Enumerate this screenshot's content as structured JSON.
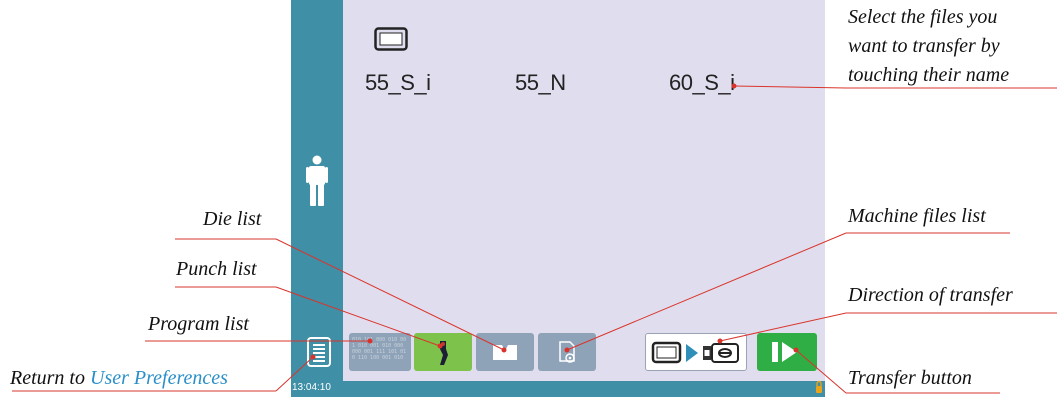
{
  "screen": {
    "files": [
      {
        "name": "55_S_i"
      },
      {
        "name": "55_N"
      },
      {
        "name": "60_S_i"
      }
    ],
    "clock": "13:04:10",
    "toolbar": {
      "program_list_text": "010 101 000 010 001 010 001 010 000 000 001 111 101 010 110 100 001 010",
      "colors": {
        "accent": "#3f8fa6",
        "background": "#e0deee",
        "button_gray": "#8fa3b8",
        "button_green": "#7dc24b",
        "transfer_green": "#2fae45"
      }
    }
  },
  "annotations": {
    "select_files": [
      "Select the files you",
      "want to transfer by",
      "touching their name"
    ],
    "die_list": "Die list",
    "punch_list": "Punch list",
    "program_list": "Program list",
    "return_prefix": "Return to ",
    "return_link": "User Preferences",
    "machine_files_list": "Machine files list",
    "direction_of_transfer": "Direction of transfer",
    "transfer_button": "Transfer button"
  }
}
